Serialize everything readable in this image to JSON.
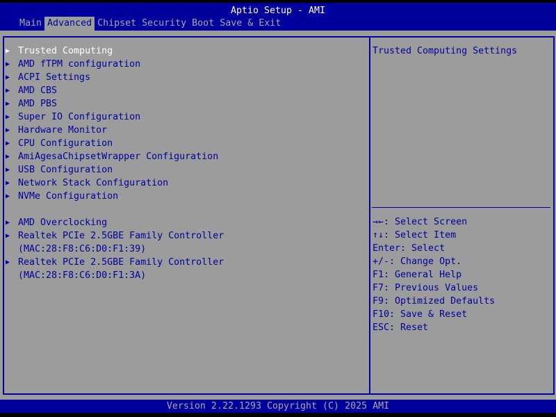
{
  "header": {
    "title": "Aptio Setup - AMI",
    "tabs": [
      {
        "label": "Main"
      },
      {
        "label": "Advanced",
        "active": true
      },
      {
        "label": "Chipset"
      },
      {
        "label": "Security"
      },
      {
        "label": "Boot"
      },
      {
        "label": "Save & Exit"
      }
    ]
  },
  "menu": {
    "items": [
      {
        "label": "Trusted Computing",
        "submenu": true,
        "selected": true
      },
      {
        "label": "AMD fTPM configuration",
        "submenu": true
      },
      {
        "label": "ACPI Settings",
        "submenu": true
      },
      {
        "label": "AMD CBS",
        "submenu": true
      },
      {
        "label": "AMD PBS",
        "submenu": true
      },
      {
        "label": "Super IO Configuration",
        "submenu": true
      },
      {
        "label": "Hardware Monitor",
        "submenu": true
      },
      {
        "label": "CPU Configuration",
        "submenu": true
      },
      {
        "label": "AmiAgesaChipsetWrapper Configuration",
        "submenu": true
      },
      {
        "label": "USB Configuration",
        "submenu": true
      },
      {
        "label": "Network Stack Configuration",
        "submenu": true
      },
      {
        "label": "NVMe Configuration",
        "submenu": true
      },
      {
        "label": "AMD Overclocking",
        "submenu": true
      },
      {
        "label": "Realtek PCIe 2.5GBE Family Controller",
        "submenu": true
      },
      {
        "label": "(MAC:28:F8:C6:D0:F1:39)",
        "submenu": false
      },
      {
        "label": "Realtek PCIe 2.5GBE Family Controller",
        "submenu": true
      },
      {
        "label": "(MAC:28:F8:C6:D0:F1:3A)",
        "submenu": false
      }
    ]
  },
  "help": {
    "text": "Trusted Computing Settings"
  },
  "keys": [
    "→←: Select Screen",
    "↑↓: Select Item",
    "Enter: Select",
    "+/-: Change Opt.",
    "F1: General Help",
    "F7: Previous Values",
    "F9: Optimized Defaults",
    "F10: Save & Reset",
    "ESC: Reset"
  ],
  "footer": {
    "text": "Version 2.22.1293 Copyright (C) 2025 AMI"
  },
  "colors": {
    "blue": "#00009c",
    "gray": "#9c9c9c",
    "selected": "#ffffff"
  }
}
